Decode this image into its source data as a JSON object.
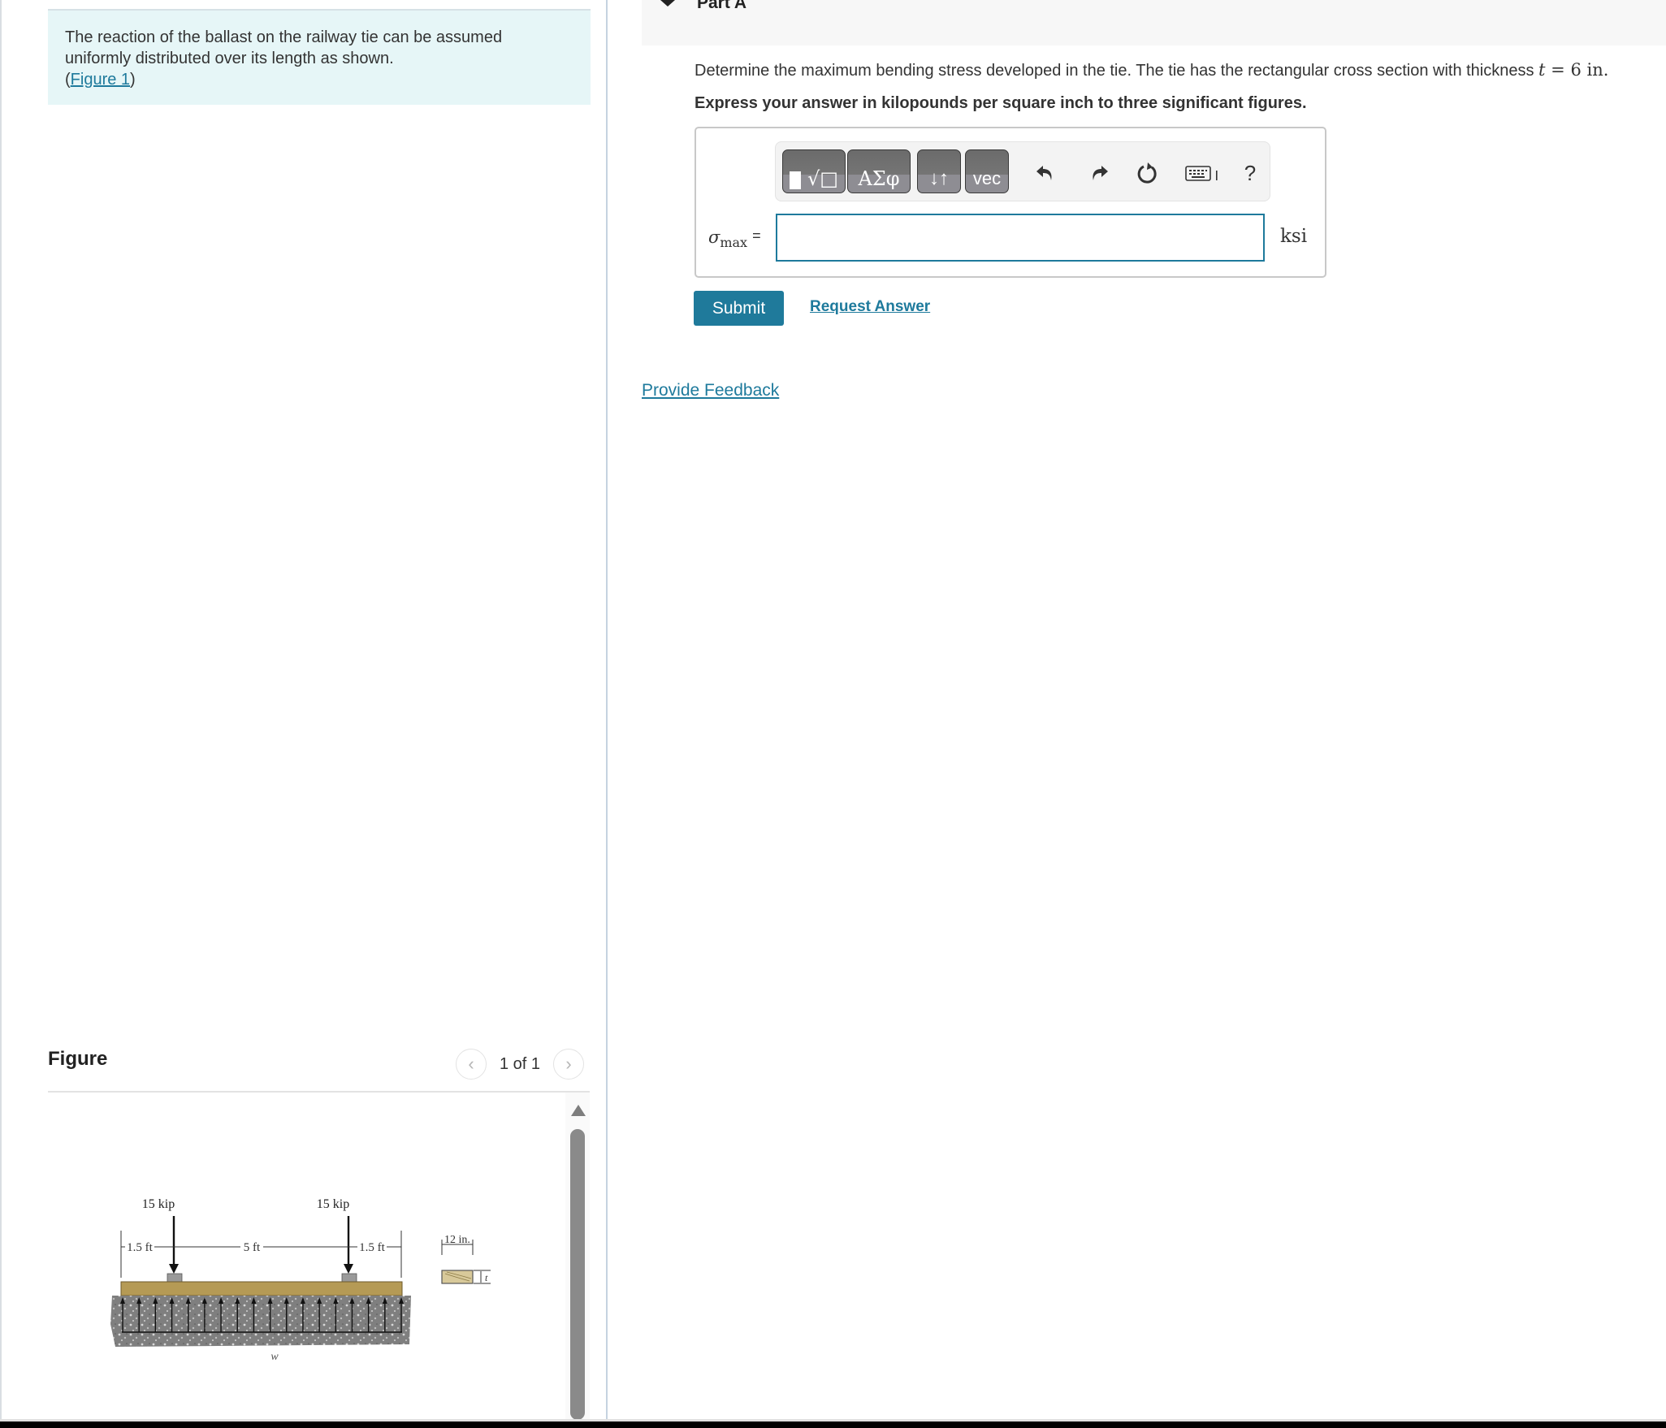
{
  "intro": {
    "text_line1": "The reaction of the ballast on the railway tie can be assumed",
    "text_line2": "uniformly distributed over its length as shown.",
    "figure_link_open": "(",
    "figure_link": "Figure 1",
    "figure_link_close": ")"
  },
  "figure_panel": {
    "title": "Figure",
    "counter": "1 of 1",
    "prev_icon": "chevron-left-icon",
    "next_icon": "chevron-right-icon",
    "diagram": {
      "load_left": "15 kip",
      "load_right": "15 kip",
      "dim_left": "1.5 ft",
      "dim_middle": "5 ft",
      "dim_right": "1.5 ft",
      "distributed_label": "w",
      "section_width": "12 in.",
      "section_thickness": "t"
    }
  },
  "part": {
    "title": "Part A",
    "question_text": "Determine the maximum bending stress developed in the tie. The tie has the rectangular cross section with thickness ",
    "question_var": "t",
    "question_eq": " = 6 in.",
    "instruction": "Express your answer in kilopounds per square inch to three significant figures."
  },
  "answer": {
    "toolbar": {
      "templates_label": "√□",
      "greek_label": "ΑΣφ",
      "arrows_label": "↓↑",
      "vec_label": "vec",
      "undo_icon": "undo-icon",
      "redo_icon": "redo-icon",
      "reset_icon": "reset-icon",
      "keyboard_icon": "keyboard-icon",
      "help_label": "?"
    },
    "variable_symbol": "σ",
    "variable_subscript": "max",
    "equals": "=",
    "input_value": "",
    "unit": "ksi"
  },
  "actions": {
    "submit_label": "Submit",
    "request_answer_label": "Request Answer",
    "feedback_label": "Provide Feedback"
  },
  "colors": {
    "accent": "#1f7a9b",
    "intro_bg": "#e6f6f7",
    "header_bg": "#f7f7f7"
  }
}
